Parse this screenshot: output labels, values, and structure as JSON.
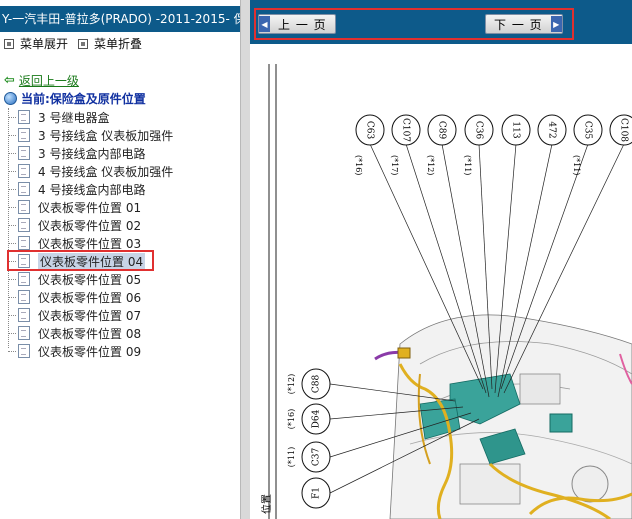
{
  "window": {
    "title": "Y-一汽丰田-普拉多(PRADO) -2011-2015- 保"
  },
  "menu_ops": {
    "expand": "菜单展开",
    "collapse": "菜单折叠"
  },
  "nav": {
    "back": "返回上一级",
    "current": "当前:保险盒及原件位置"
  },
  "tree": [
    "3 号继电器盒",
    "3 号接线盒 仪表板加强件",
    "3 号接线盒内部电路",
    "4 号接线盒 仪表板加强件",
    "4 号接线盒内部电路",
    "仪表板零件位置 01",
    "仪表板零件位置 02",
    "仪表板零件位置 03",
    "仪表板零件位置 04",
    "仪表板零件位置 05",
    "仪表板零件位置 06",
    "仪表板零件位置 07",
    "仪表板零件位置 08",
    "仪表板零件位置 09"
  ],
  "selected_index": 8,
  "pager": {
    "prev": "上 一 页",
    "next": "下 一 页"
  },
  "diagram": {
    "top_connectors": [
      {
        "id": "C63",
        "tag": "(*16)"
      },
      {
        "id": "C107",
        "tag": "(*17)"
      },
      {
        "id": "C89",
        "tag": "(*12)"
      },
      {
        "id": "C36",
        "tag": "(*11)"
      },
      {
        "id": "113",
        "tag": ""
      },
      {
        "id": "472",
        "tag": ""
      },
      {
        "id": "C35",
        "tag": "(*11)"
      },
      {
        "id": "C108",
        "tag": ""
      }
    ],
    "left_connectors": [
      {
        "id": "C88",
        "tag": "(*12)"
      },
      {
        "id": "D64",
        "tag": "(*16)"
      },
      {
        "id": "C37",
        "tag": "(*11)"
      },
      {
        "id": "F1",
        "tag": ""
      }
    ],
    "side_caption": "位置"
  },
  "colors": {
    "titlebar": "#0d5a8a",
    "highlight": "#e03030",
    "back_link": "#1a7a1a",
    "current": "#1030a0"
  }
}
